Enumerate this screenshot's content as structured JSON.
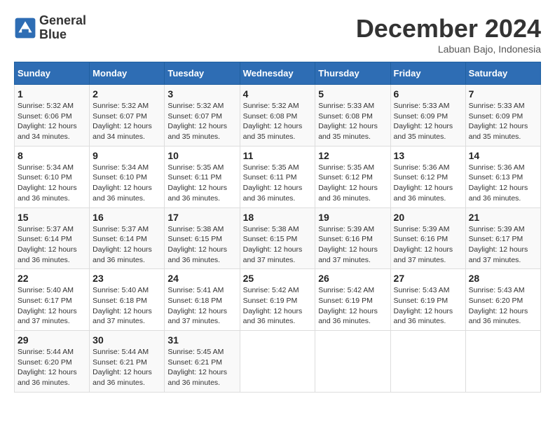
{
  "header": {
    "logo_line1": "General",
    "logo_line2": "Blue",
    "month": "December 2024",
    "location": "Labuan Bajo, Indonesia"
  },
  "weekdays": [
    "Sunday",
    "Monday",
    "Tuesday",
    "Wednesday",
    "Thursday",
    "Friday",
    "Saturday"
  ],
  "weeks": [
    [
      {
        "day": "1",
        "info": "Sunrise: 5:32 AM\nSunset: 6:06 PM\nDaylight: 12 hours\nand 34 minutes."
      },
      {
        "day": "2",
        "info": "Sunrise: 5:32 AM\nSunset: 6:07 PM\nDaylight: 12 hours\nand 34 minutes."
      },
      {
        "day": "3",
        "info": "Sunrise: 5:32 AM\nSunset: 6:07 PM\nDaylight: 12 hours\nand 35 minutes."
      },
      {
        "day": "4",
        "info": "Sunrise: 5:32 AM\nSunset: 6:08 PM\nDaylight: 12 hours\nand 35 minutes."
      },
      {
        "day": "5",
        "info": "Sunrise: 5:33 AM\nSunset: 6:08 PM\nDaylight: 12 hours\nand 35 minutes."
      },
      {
        "day": "6",
        "info": "Sunrise: 5:33 AM\nSunset: 6:09 PM\nDaylight: 12 hours\nand 35 minutes."
      },
      {
        "day": "7",
        "info": "Sunrise: 5:33 AM\nSunset: 6:09 PM\nDaylight: 12 hours\nand 35 minutes."
      }
    ],
    [
      {
        "day": "8",
        "info": "Sunrise: 5:34 AM\nSunset: 6:10 PM\nDaylight: 12 hours\nand 36 minutes."
      },
      {
        "day": "9",
        "info": "Sunrise: 5:34 AM\nSunset: 6:10 PM\nDaylight: 12 hours\nand 36 minutes."
      },
      {
        "day": "10",
        "info": "Sunrise: 5:35 AM\nSunset: 6:11 PM\nDaylight: 12 hours\nand 36 minutes."
      },
      {
        "day": "11",
        "info": "Sunrise: 5:35 AM\nSunset: 6:11 PM\nDaylight: 12 hours\nand 36 minutes."
      },
      {
        "day": "12",
        "info": "Sunrise: 5:35 AM\nSunset: 6:12 PM\nDaylight: 12 hours\nand 36 minutes."
      },
      {
        "day": "13",
        "info": "Sunrise: 5:36 AM\nSunset: 6:12 PM\nDaylight: 12 hours\nand 36 minutes."
      },
      {
        "day": "14",
        "info": "Sunrise: 5:36 AM\nSunset: 6:13 PM\nDaylight: 12 hours\nand 36 minutes."
      }
    ],
    [
      {
        "day": "15",
        "info": "Sunrise: 5:37 AM\nSunset: 6:14 PM\nDaylight: 12 hours\nand 36 minutes."
      },
      {
        "day": "16",
        "info": "Sunrise: 5:37 AM\nSunset: 6:14 PM\nDaylight: 12 hours\nand 36 minutes."
      },
      {
        "day": "17",
        "info": "Sunrise: 5:38 AM\nSunset: 6:15 PM\nDaylight: 12 hours\nand 36 minutes."
      },
      {
        "day": "18",
        "info": "Sunrise: 5:38 AM\nSunset: 6:15 PM\nDaylight: 12 hours\nand 37 minutes."
      },
      {
        "day": "19",
        "info": "Sunrise: 5:39 AM\nSunset: 6:16 PM\nDaylight: 12 hours\nand 37 minutes."
      },
      {
        "day": "20",
        "info": "Sunrise: 5:39 AM\nSunset: 6:16 PM\nDaylight: 12 hours\nand 37 minutes."
      },
      {
        "day": "21",
        "info": "Sunrise: 5:39 AM\nSunset: 6:17 PM\nDaylight: 12 hours\nand 37 minutes."
      }
    ],
    [
      {
        "day": "22",
        "info": "Sunrise: 5:40 AM\nSunset: 6:17 PM\nDaylight: 12 hours\nand 37 minutes."
      },
      {
        "day": "23",
        "info": "Sunrise: 5:40 AM\nSunset: 6:18 PM\nDaylight: 12 hours\nand 37 minutes."
      },
      {
        "day": "24",
        "info": "Sunrise: 5:41 AM\nSunset: 6:18 PM\nDaylight: 12 hours\nand 37 minutes."
      },
      {
        "day": "25",
        "info": "Sunrise: 5:42 AM\nSunset: 6:19 PM\nDaylight: 12 hours\nand 36 minutes."
      },
      {
        "day": "26",
        "info": "Sunrise: 5:42 AM\nSunset: 6:19 PM\nDaylight: 12 hours\nand 36 minutes."
      },
      {
        "day": "27",
        "info": "Sunrise: 5:43 AM\nSunset: 6:19 PM\nDaylight: 12 hours\nand 36 minutes."
      },
      {
        "day": "28",
        "info": "Sunrise: 5:43 AM\nSunset: 6:20 PM\nDaylight: 12 hours\nand 36 minutes."
      }
    ],
    [
      {
        "day": "29",
        "info": "Sunrise: 5:44 AM\nSunset: 6:20 PM\nDaylight: 12 hours\nand 36 minutes."
      },
      {
        "day": "30",
        "info": "Sunrise: 5:44 AM\nSunset: 6:21 PM\nDaylight: 12 hours\nand 36 minutes."
      },
      {
        "day": "31",
        "info": "Sunrise: 5:45 AM\nSunset: 6:21 PM\nDaylight: 12 hours\nand 36 minutes."
      },
      null,
      null,
      null,
      null
    ]
  ]
}
